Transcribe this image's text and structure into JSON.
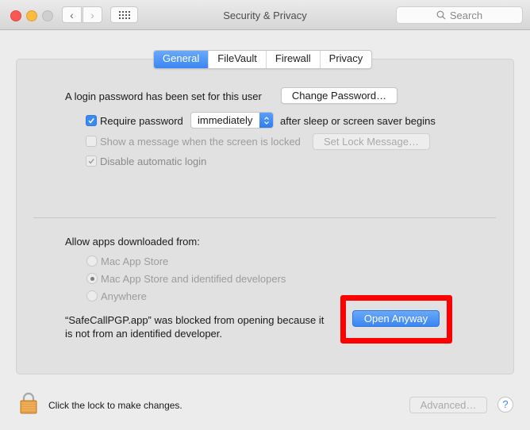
{
  "window": {
    "title": "Security & Privacy",
    "search_placeholder": "Search",
    "traffic_lights": [
      "close",
      "minimize",
      "zoom"
    ],
    "nav": {
      "back_icon": "chevron-left-icon",
      "forward_icon": "chevron-right-icon",
      "show_all_icon": "grid-icon"
    }
  },
  "tabs": [
    {
      "label": "General",
      "active": true
    },
    {
      "label": "FileVault",
      "active": false
    },
    {
      "label": "Firewall",
      "active": false
    },
    {
      "label": "Privacy",
      "active": false
    }
  ],
  "general": {
    "password_set_text": "A login password has been set for this user",
    "change_password_label": "Change Password…",
    "require_password": {
      "label": "Require password",
      "checked": true
    },
    "require_password_select": {
      "value": "immediately"
    },
    "after_sleep_text": "after sleep or screen saver begins",
    "show_message": {
      "label": "Show a message when the screen is locked",
      "checked": false,
      "enabled": false
    },
    "set_lock_message_label": "Set Lock Message…",
    "disable_auto_login": {
      "label": "Disable automatic login",
      "checked": true,
      "enabled": false
    }
  },
  "allow_apps": {
    "heading": "Allow apps downloaded from:",
    "options": [
      {
        "label": "Mac App Store",
        "selected": false
      },
      {
        "label": "Mac App Store and identified developers",
        "selected": true
      },
      {
        "label": "Anywhere",
        "selected": false
      }
    ],
    "blocked_line1": "“SafeCallPGP.app” was blocked from opening because it",
    "blocked_line2": "is not from an identified developer.",
    "open_anyway_label": "Open Anyway",
    "highlight_color": "#ff0000"
  },
  "footer": {
    "lock_text": "Click the lock to make changes.",
    "advanced_label": "Advanced…",
    "help_label": "?"
  }
}
